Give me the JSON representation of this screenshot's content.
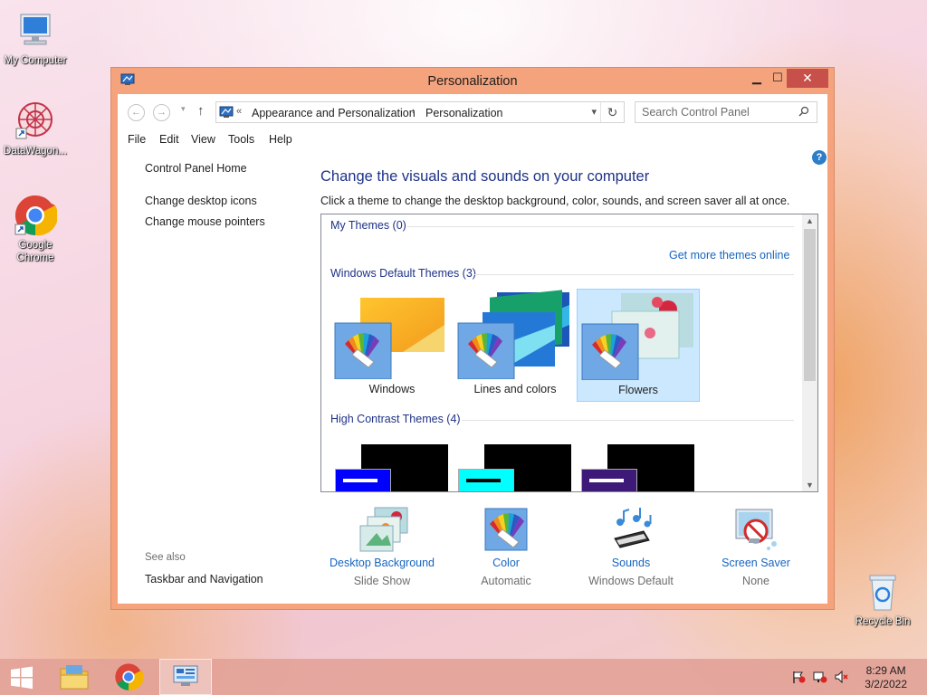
{
  "desktop": {
    "icons": [
      {
        "label": "My Computer"
      },
      {
        "label": "DataWagon..."
      },
      {
        "label": "Google Chrome"
      },
      {
        "label": "Recycle Bin"
      }
    ]
  },
  "window": {
    "title": "Personalization",
    "controls": {
      "minimize": "▁",
      "maximize": "☐",
      "close": "✕"
    },
    "address": {
      "prefix": "«",
      "crumbs": [
        "Appearance and Personalization",
        "Personalization"
      ],
      "separator": "›"
    },
    "search": {
      "placeholder": "Search Control Panel"
    },
    "menu": [
      "File",
      "Edit",
      "View",
      "Tools",
      "Help"
    ],
    "left_pane": {
      "home": "Control Panel Home",
      "links": [
        "Change desktop icons",
        "Change mouse pointers"
      ],
      "see_also_label": "See also",
      "see_also": [
        "Taskbar and Navigation"
      ]
    },
    "main": {
      "heading": "Change the visuals and sounds on your computer",
      "subtext": "Click a theme to change the desktop background, color, sounds, and screen saver all at once.",
      "groups": {
        "my_themes": "My Themes (0)",
        "get_more": "Get more themes online",
        "default_themes": "Windows Default Themes (3)",
        "high_contrast": "High Contrast Themes (4)"
      },
      "themes": [
        {
          "name": "Windows",
          "selected": false
        },
        {
          "name": "Lines and colors",
          "selected": false
        },
        {
          "name": "Flowers",
          "selected": true
        }
      ],
      "high_contrast_accents": [
        "#0000ff",
        "#00ffff",
        "#5a2d82"
      ]
    },
    "options": [
      {
        "link": "Desktop Background",
        "value": "Slide Show"
      },
      {
        "link": "Color",
        "value": "Automatic"
      },
      {
        "link": "Sounds",
        "value": "Windows Default"
      },
      {
        "link": "Screen Saver",
        "value": "None"
      }
    ]
  },
  "taskbar": {
    "time": "8:29 AM",
    "date": "3/2/2022"
  },
  "colors": {
    "link": "#1665c0",
    "heading": "#1e3287",
    "selection": "#cce8ff",
    "window_frame": "#f4a37d"
  }
}
